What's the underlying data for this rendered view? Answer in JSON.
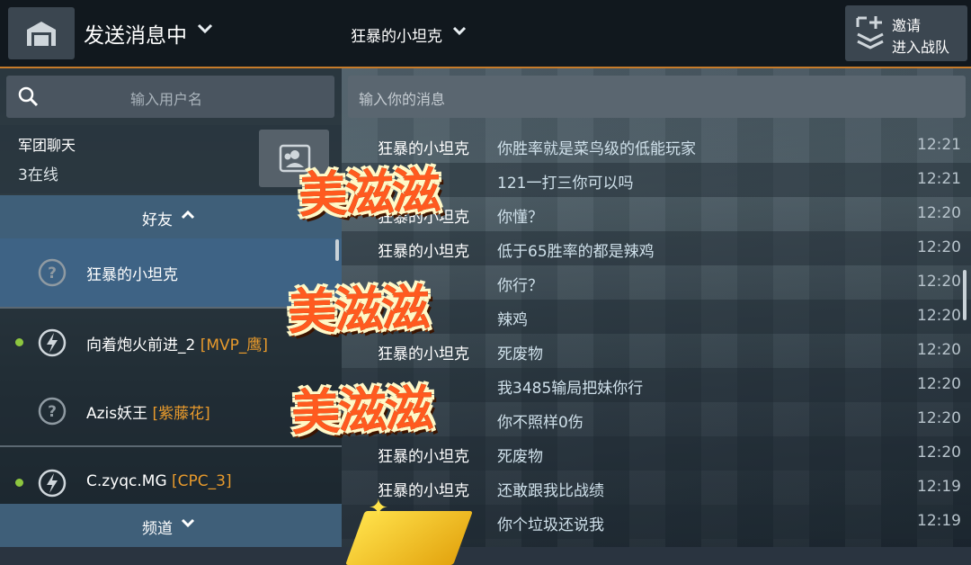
{
  "header": {
    "title": "发送消息中",
    "center_title": "狂暴的小坦克",
    "invite_line1": "邀请",
    "invite_line2": "进入战队"
  },
  "sidebar": {
    "search_placeholder": "输入用户名",
    "clan": {
      "title": "军团聊天",
      "online": "3在线"
    },
    "friends_header": "好友",
    "channels_header": "频道",
    "friends": [
      {
        "name": "狂暴的小坦克",
        "tag": "",
        "status": "unknown",
        "online": false,
        "selected": true
      },
      {
        "name": "向着炮火前进_2 ",
        "tag": "[MVP_鹰]",
        "status": "in-battle",
        "online": true,
        "selected": false
      },
      {
        "name": "Azis妖王 ",
        "tag": "[紫藤花]",
        "status": "unknown",
        "online": false,
        "selected": false
      },
      {
        "name": "C.zyqc.MG ",
        "tag": "[CPC_3]",
        "status": "in-battle",
        "online": true,
        "selected": false
      }
    ]
  },
  "chat": {
    "input_placeholder": "输入你的消息",
    "messages": [
      {
        "sender": "狂暴的小坦克",
        "text": "你胜率就是菜鸟级的低能玩家",
        "time": "12:21"
      },
      {
        "sender": "",
        "text": "121一打三你可以吗",
        "time": "12:21"
      },
      {
        "sender": "狂暴的小坦克",
        "text": "你懂？",
        "time": "12:20"
      },
      {
        "sender": "狂暴的小坦克",
        "text": "低于65胜率的都是辣鸡",
        "time": "12:20"
      },
      {
        "sender": "",
        "text": "你行？",
        "time": "12:20"
      },
      {
        "sender": "",
        "text": "辣鸡",
        "time": "12:20"
      },
      {
        "sender": "狂暴的小坦克",
        "text": "死废物",
        "time": "12:20"
      },
      {
        "sender": "",
        "text": "我3485输局把妹你行",
        "time": "12:20"
      },
      {
        "sender": "",
        "text": "你不照样0伤",
        "time": "12:20"
      },
      {
        "sender": "狂暴的小坦克",
        "text": "死废物",
        "time": "12:20"
      },
      {
        "sender": "狂暴的小坦克",
        "text": "还敢跟我比战绩",
        "time": "12:19"
      },
      {
        "sender": "",
        "text": "你个垃圾还说我",
        "time": "12:19"
      }
    ]
  },
  "stickers": [
    "美滋滋",
    "美滋滋",
    "美滋滋"
  ],
  "colors": {
    "accent": "#c77b2a",
    "tag": "#e89a2c",
    "selected": "#3e6385",
    "online": "#8dc63f"
  }
}
